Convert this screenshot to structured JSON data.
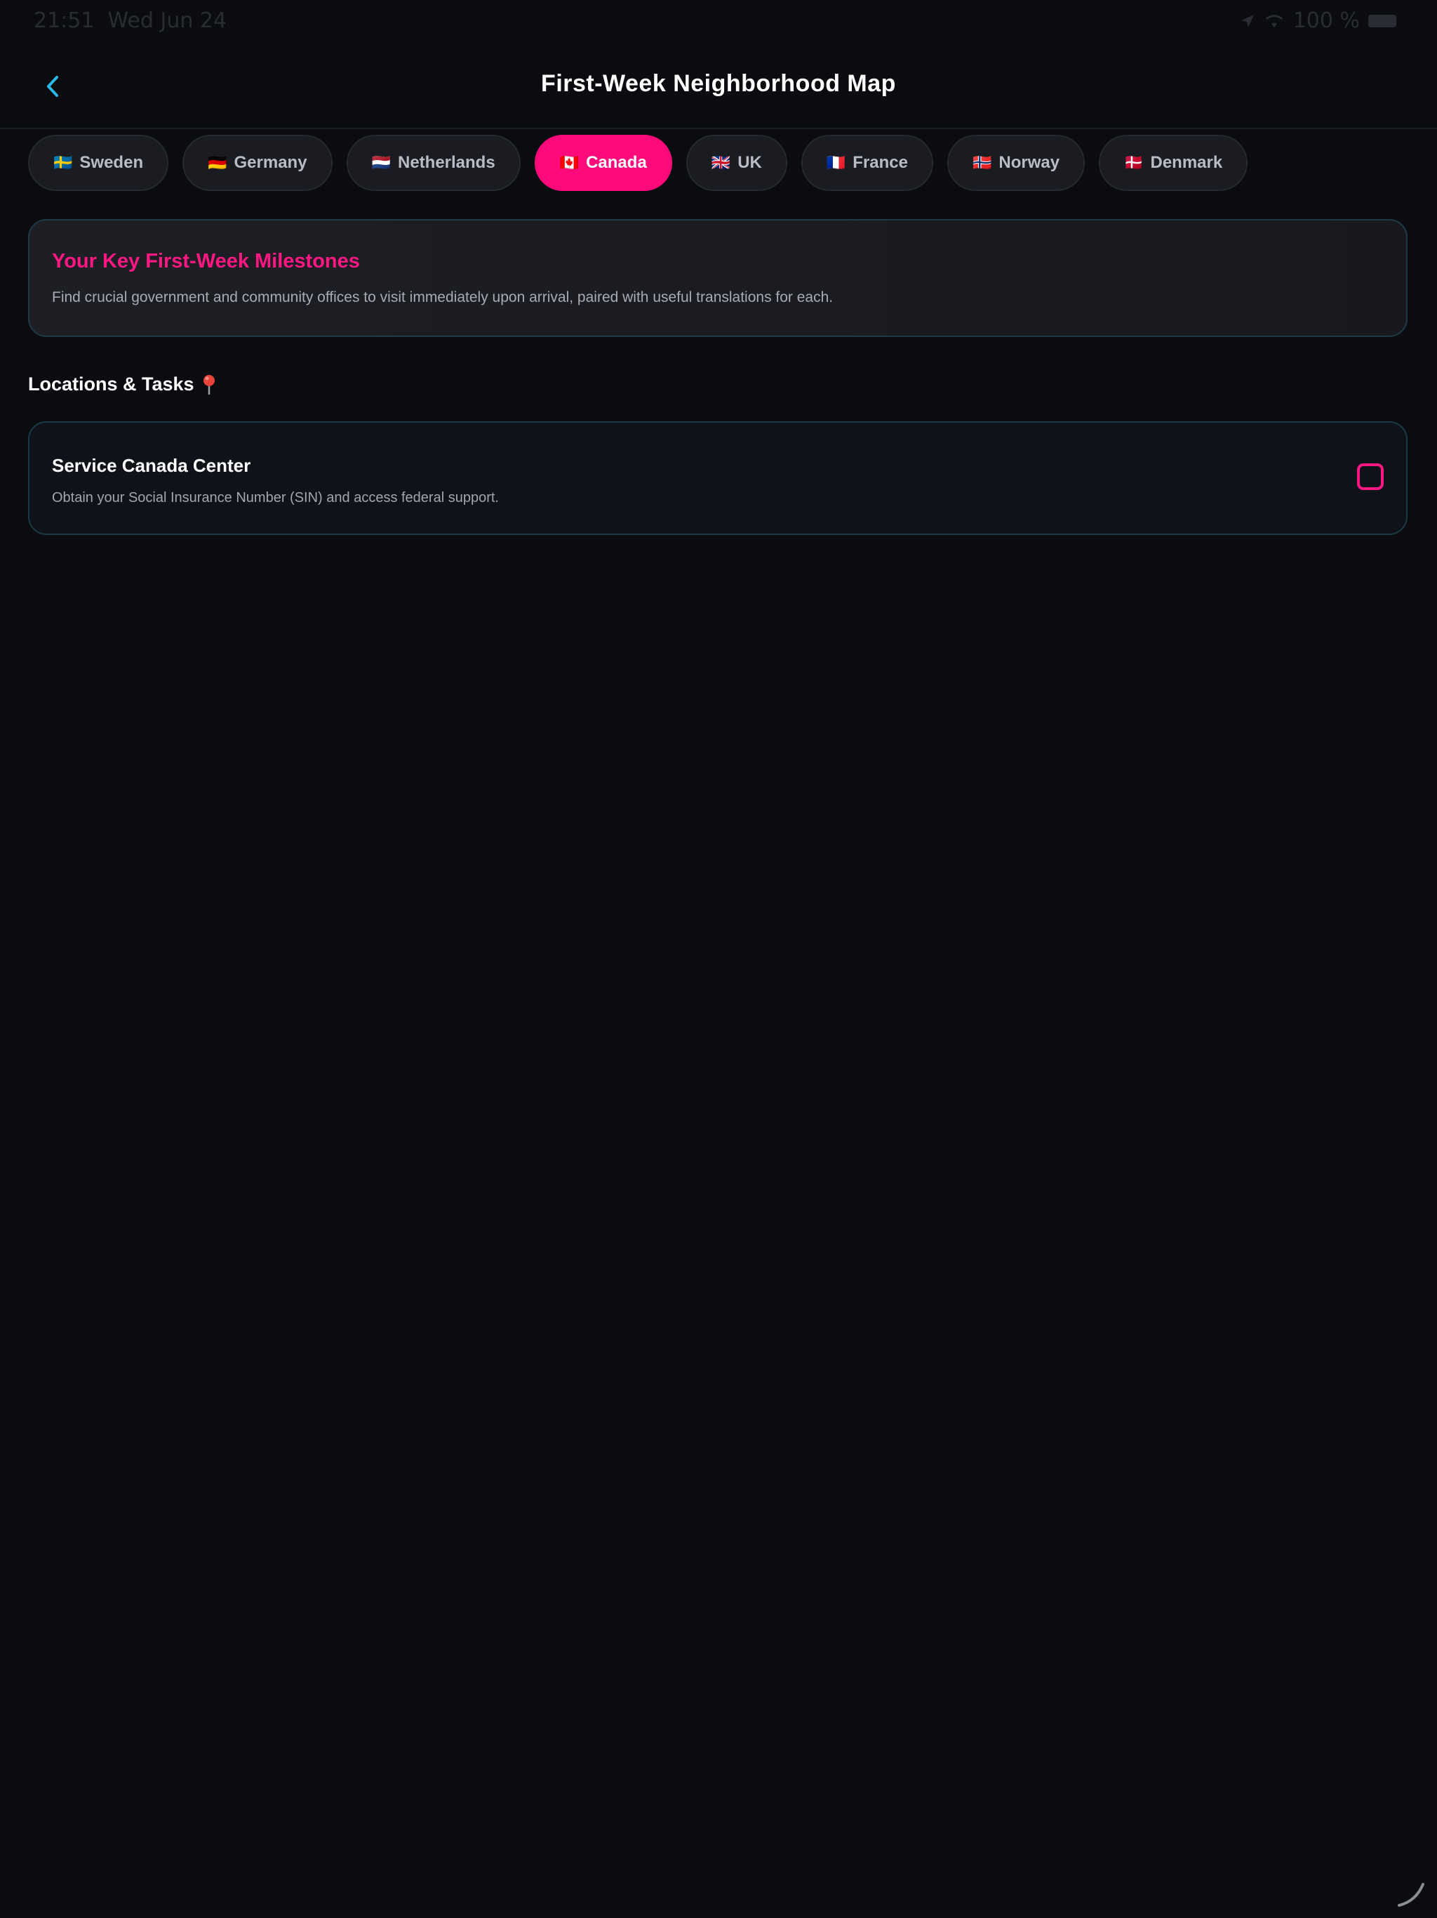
{
  "status_bar": {
    "time": "21:51",
    "date": "Wed Jun 24",
    "battery": "100 %"
  },
  "nav": {
    "title": "First-Week Neighborhood Map",
    "back_icon": "chevron-left-icon",
    "accent_color": "#2ab8e6"
  },
  "tabs": [
    {
      "flag": "🇸🇪",
      "label": "Sweden",
      "active": false
    },
    {
      "flag": "🇩🇪",
      "label": "Germany",
      "active": false
    },
    {
      "flag": "🇳🇱",
      "label": "Netherlands",
      "active": false
    },
    {
      "flag": "🇨🇦",
      "label": "Canada",
      "active": true
    },
    {
      "flag": "🇬🇧",
      "label": "UK",
      "active": false
    },
    {
      "flag": "🇫🇷",
      "label": "France",
      "active": false
    },
    {
      "flag": "🇳🇴",
      "label": "Norway",
      "active": false
    },
    {
      "flag": "🇩🇰",
      "label": "Denmark",
      "active": false
    }
  ],
  "milestones": {
    "title": "Your Key First-Week Milestones",
    "description": "Find crucial government and community offices to visit immediately upon arrival, paired with useful translations for each."
  },
  "section": {
    "title": "Locations & Tasks",
    "icon": "pin-icon"
  },
  "tasks": [
    {
      "title": "Service Canada Center",
      "description": "Obtain your Social Insurance Number (SIN) and access federal support.",
      "checked": false
    }
  ],
  "colors": {
    "background": "#0b0c10",
    "primary_accent": "#ff0a7a",
    "card_border": "#1f3a44"
  }
}
